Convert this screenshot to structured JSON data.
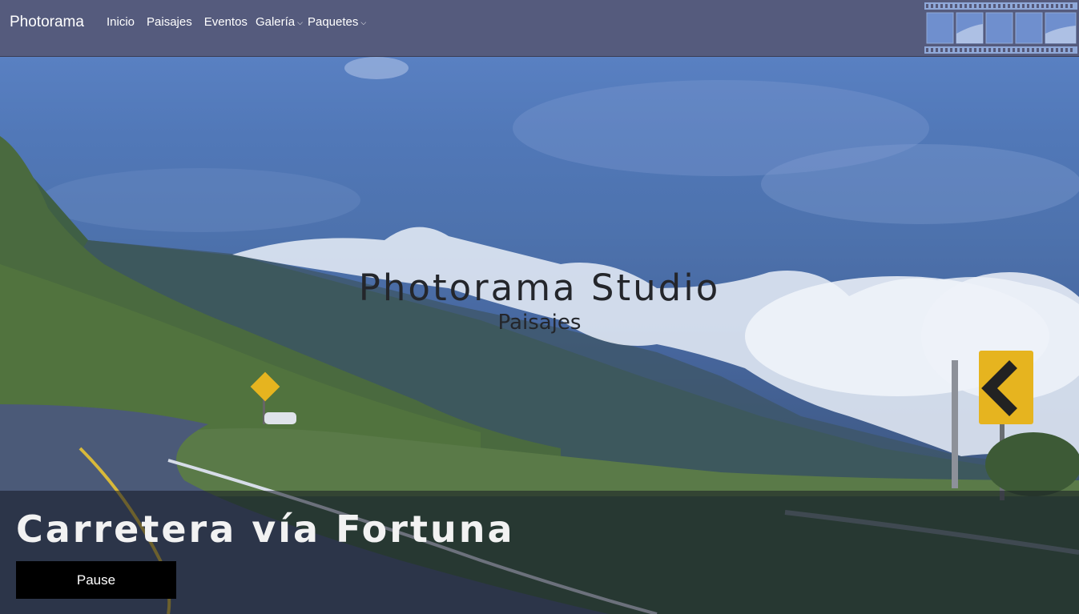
{
  "navbar": {
    "brand": "Photorama",
    "links": [
      {
        "label": "Inicio"
      },
      {
        "label": "Paisajes"
      },
      {
        "label": "Eventos"
      },
      {
        "label": "Galería"
      },
      {
        "label": "Paquetes"
      }
    ]
  },
  "hero": {
    "title": "Photorama Studio",
    "subtitle": "Paisajes"
  },
  "caption": {
    "title": "Carretera vía Fortuna",
    "button_label": "Pause"
  },
  "colors": {
    "navbar_bg": "#555878",
    "caption_button_bg": "#000000",
    "sign_yellow": "#e6b41f"
  }
}
